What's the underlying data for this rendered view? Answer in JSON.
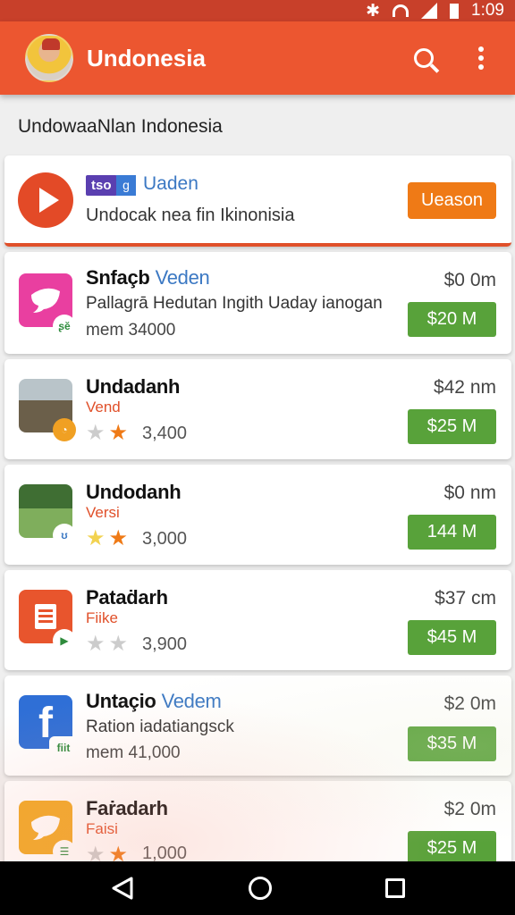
{
  "status": {
    "time": "1:09"
  },
  "appbar": {
    "title": "Undonesia"
  },
  "subheader": "UndowaaNlan Indonesia",
  "featured": {
    "tag": "tso",
    "tag2": "g",
    "version": "Uaden",
    "description": "Undocak nea fin Ikinonisia",
    "button": "Ueason"
  },
  "apps": [
    {
      "name": "Snfaçb",
      "version": "Veden",
      "line1": "Pallagrā Hedutan Ingith Uaday ianogan",
      "line2": "mem 34000",
      "price": "$0 0m",
      "button": "$20 M",
      "icon": "bird-icon",
      "color": "#e93fa0"
    },
    {
      "name": "Undadanh",
      "version": "",
      "line1": "Vend",
      "stars": 1,
      "rating_count": "3,400",
      "price": "$42 nm",
      "button": "$25 M",
      "icon": "person-photo-icon",
      "color": "#6b5f4a"
    },
    {
      "name": "Undodanh",
      "version": "",
      "line1": "Versi",
      "stars": 2,
      "rating_count": "3,000",
      "price": "$0 nm",
      "button": "144 M",
      "icon": "landscape-photo-icon",
      "color": "#4f7f3b"
    },
    {
      "name": "Pataḋarh",
      "version": "",
      "line1": "Fiike",
      "stars": 0,
      "rating_count": "3,900",
      "price": "$37 cm",
      "button": "$45 M",
      "icon": "document-icon",
      "color": "#e8552d"
    },
    {
      "name": "Untaçio",
      "version": "Vedem",
      "line1": "Ration iadatiangsck",
      "line2": "mem 41,000",
      "price": "$2 0m",
      "button": "$35 M",
      "icon": "facebook-icon",
      "color": "#2f6fd6"
    },
    {
      "name": "Faṙadarh",
      "version": "",
      "line1": "Faisi",
      "stars": 1,
      "rating_count": "1,000",
      "price": "$2 0m",
      "button": "$25 M",
      "icon": "bird-icon",
      "color": "#f2a823"
    }
  ],
  "badges": {
    "b1": "ʂĕ",
    "b2": "◔",
    "b3": "ʊ",
    "b4": "▶",
    "b5": "fiit",
    "b6": "☰"
  },
  "colors": {
    "appbar": "#ec5630",
    "accent_green": "#58a23a",
    "accent_orange": "#ef7a16"
  }
}
